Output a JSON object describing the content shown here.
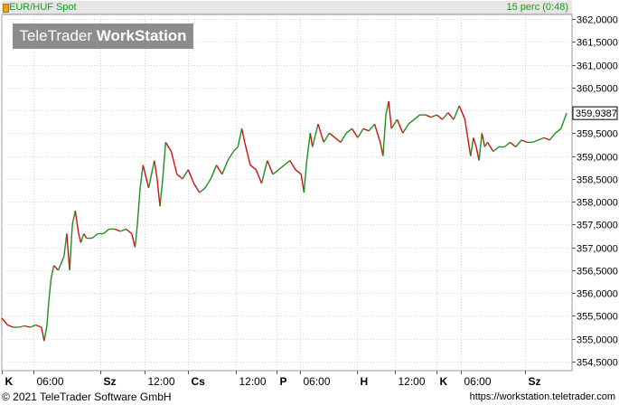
{
  "header": {
    "symbol": "EUR/HUF Spot",
    "interval": "15 perc (0:48)"
  },
  "watermark": {
    "brand_regular": "TeleTrader ",
    "brand_bold": "WorkStation"
  },
  "footer": {
    "copyright": "© 2021 TeleTrader Software GmbH",
    "url": "https://workstation.teletrader.com"
  },
  "colors": {
    "up": "#1f8f1f",
    "down": "#d01010",
    "grid": "#d6d6d6",
    "last_price_box": "#ffffff"
  },
  "chart_data": {
    "type": "line",
    "title": "",
    "xlabel": "",
    "ylabel": "",
    "grid": true,
    "ylim": [
      354.3,
      362.1
    ],
    "y_ticks": [
      354.5,
      355.0,
      355.5,
      356.0,
      356.5,
      357.0,
      357.5,
      358.0,
      358.5,
      359.0,
      359.5,
      360.0,
      360.5,
      361.0,
      361.5,
      362.0
    ],
    "y_tick_labels": [
      "354,5000",
      "355,0000",
      "355,5000",
      "356,0000",
      "356,5000",
      "357,0000",
      "357,5000",
      "358,0000",
      "358,5000",
      "359,0000",
      "359,5000",
      "360,0000",
      "360,5000",
      "361,0000",
      "361,5000",
      "362,0000"
    ],
    "x_range": [
      0,
      100
    ],
    "x_ticks": [
      {
        "label": "K",
        "x": 0
      },
      {
        "label": "06:00",
        "x": 5.6
      },
      {
        "label": "Sz",
        "x": 17.5
      },
      {
        "label": "12:00",
        "x": 25.2
      },
      {
        "label": "Cs",
        "x": 32.9
      },
      {
        "label": "12:00",
        "x": 41.4
      },
      {
        "label": "P",
        "x": 48.6
      },
      {
        "label": "06:00",
        "x": 52.8
      },
      {
        "label": "H",
        "x": 62.9
      },
      {
        "label": "12:00",
        "x": 69.6
      },
      {
        "label": "K",
        "x": 77.0
      },
      {
        "label": "06:00",
        "x": 81.3
      },
      {
        "label": "Sz",
        "x": 92.7
      }
    ],
    "last_price": 359.9387,
    "last_price_label": "359,9387",
    "series": [
      {
        "x": [
          0,
          1,
          2,
          3,
          4,
          5,
          6,
          7,
          7.5,
          8,
          8.3,
          8.7,
          9.2,
          10,
          11,
          11.5,
          12,
          12.5,
          13,
          13.6,
          14,
          14.5,
          15,
          16,
          17,
          18,
          19,
          20,
          21,
          22,
          23,
          23.6,
          24,
          24.5,
          25,
          26,
          27,
          27.5,
          28,
          28.5,
          29,
          30,
          31,
          32,
          33,
          34,
          35,
          36,
          37,
          38,
          39,
          40,
          41,
          41.8,
          42.5,
          43,
          44,
          45,
          46,
          47,
          48,
          49,
          50,
          51,
          52,
          53,
          53.5,
          54,
          54.6,
          55,
          56,
          57,
          58,
          59,
          60,
          61,
          62,
          63,
          64,
          65,
          66,
          67,
          67.5,
          68,
          68.5,
          69,
          70,
          71,
          72,
          73,
          74,
          75,
          76,
          77,
          78,
          79,
          80,
          81,
          82,
          82.5,
          83,
          83.5,
          84,
          84.5,
          85,
          85.5,
          86,
          87,
          88,
          89,
          90,
          91,
          92,
          93,
          94,
          95,
          96,
          97,
          98,
          99,
          100
        ],
        "y": [
          355.45,
          355.3,
          355.25,
          355.25,
          355.28,
          355.25,
          355.3,
          355.25,
          354.95,
          355.3,
          355.8,
          356.3,
          356.6,
          356.5,
          356.8,
          357.3,
          356.5,
          357.5,
          357.8,
          357.3,
          357.1,
          357.3,
          357.2,
          357.2,
          357.3,
          357.3,
          357.4,
          357.4,
          357.35,
          357.4,
          357.3,
          357.0,
          357.5,
          358.3,
          358.8,
          358.3,
          358.9,
          358.5,
          357.9,
          358.5,
          359.3,
          359.1,
          358.6,
          358.5,
          358.7,
          358.4,
          358.2,
          358.3,
          358.5,
          358.8,
          358.6,
          358.9,
          359.1,
          359.2,
          359.6,
          359.3,
          358.8,
          358.7,
          358.4,
          358.9,
          358.6,
          358.7,
          358.8,
          358.9,
          358.7,
          358.6,
          358.2,
          358.9,
          359.5,
          359.2,
          359.7,
          359.3,
          359.5,
          359.4,
          359.3,
          359.5,
          359.6,
          359.4,
          359.6,
          359.55,
          359.7,
          359.3,
          359.0,
          359.9,
          360.2,
          359.6,
          359.8,
          359.5,
          359.7,
          359.8,
          359.9,
          359.9,
          359.85,
          359.9,
          359.8,
          359.95,
          359.8,
          360.1,
          359.8,
          359.4,
          359.0,
          359.4,
          359.2,
          358.9,
          359.5,
          359.2,
          359.3,
          359.1,
          359.2,
          359.2,
          359.3,
          359.2,
          359.35,
          359.3,
          359.3,
          359.35,
          359.4,
          359.35,
          359.5,
          359.6,
          359.94
        ]
      }
    ]
  }
}
